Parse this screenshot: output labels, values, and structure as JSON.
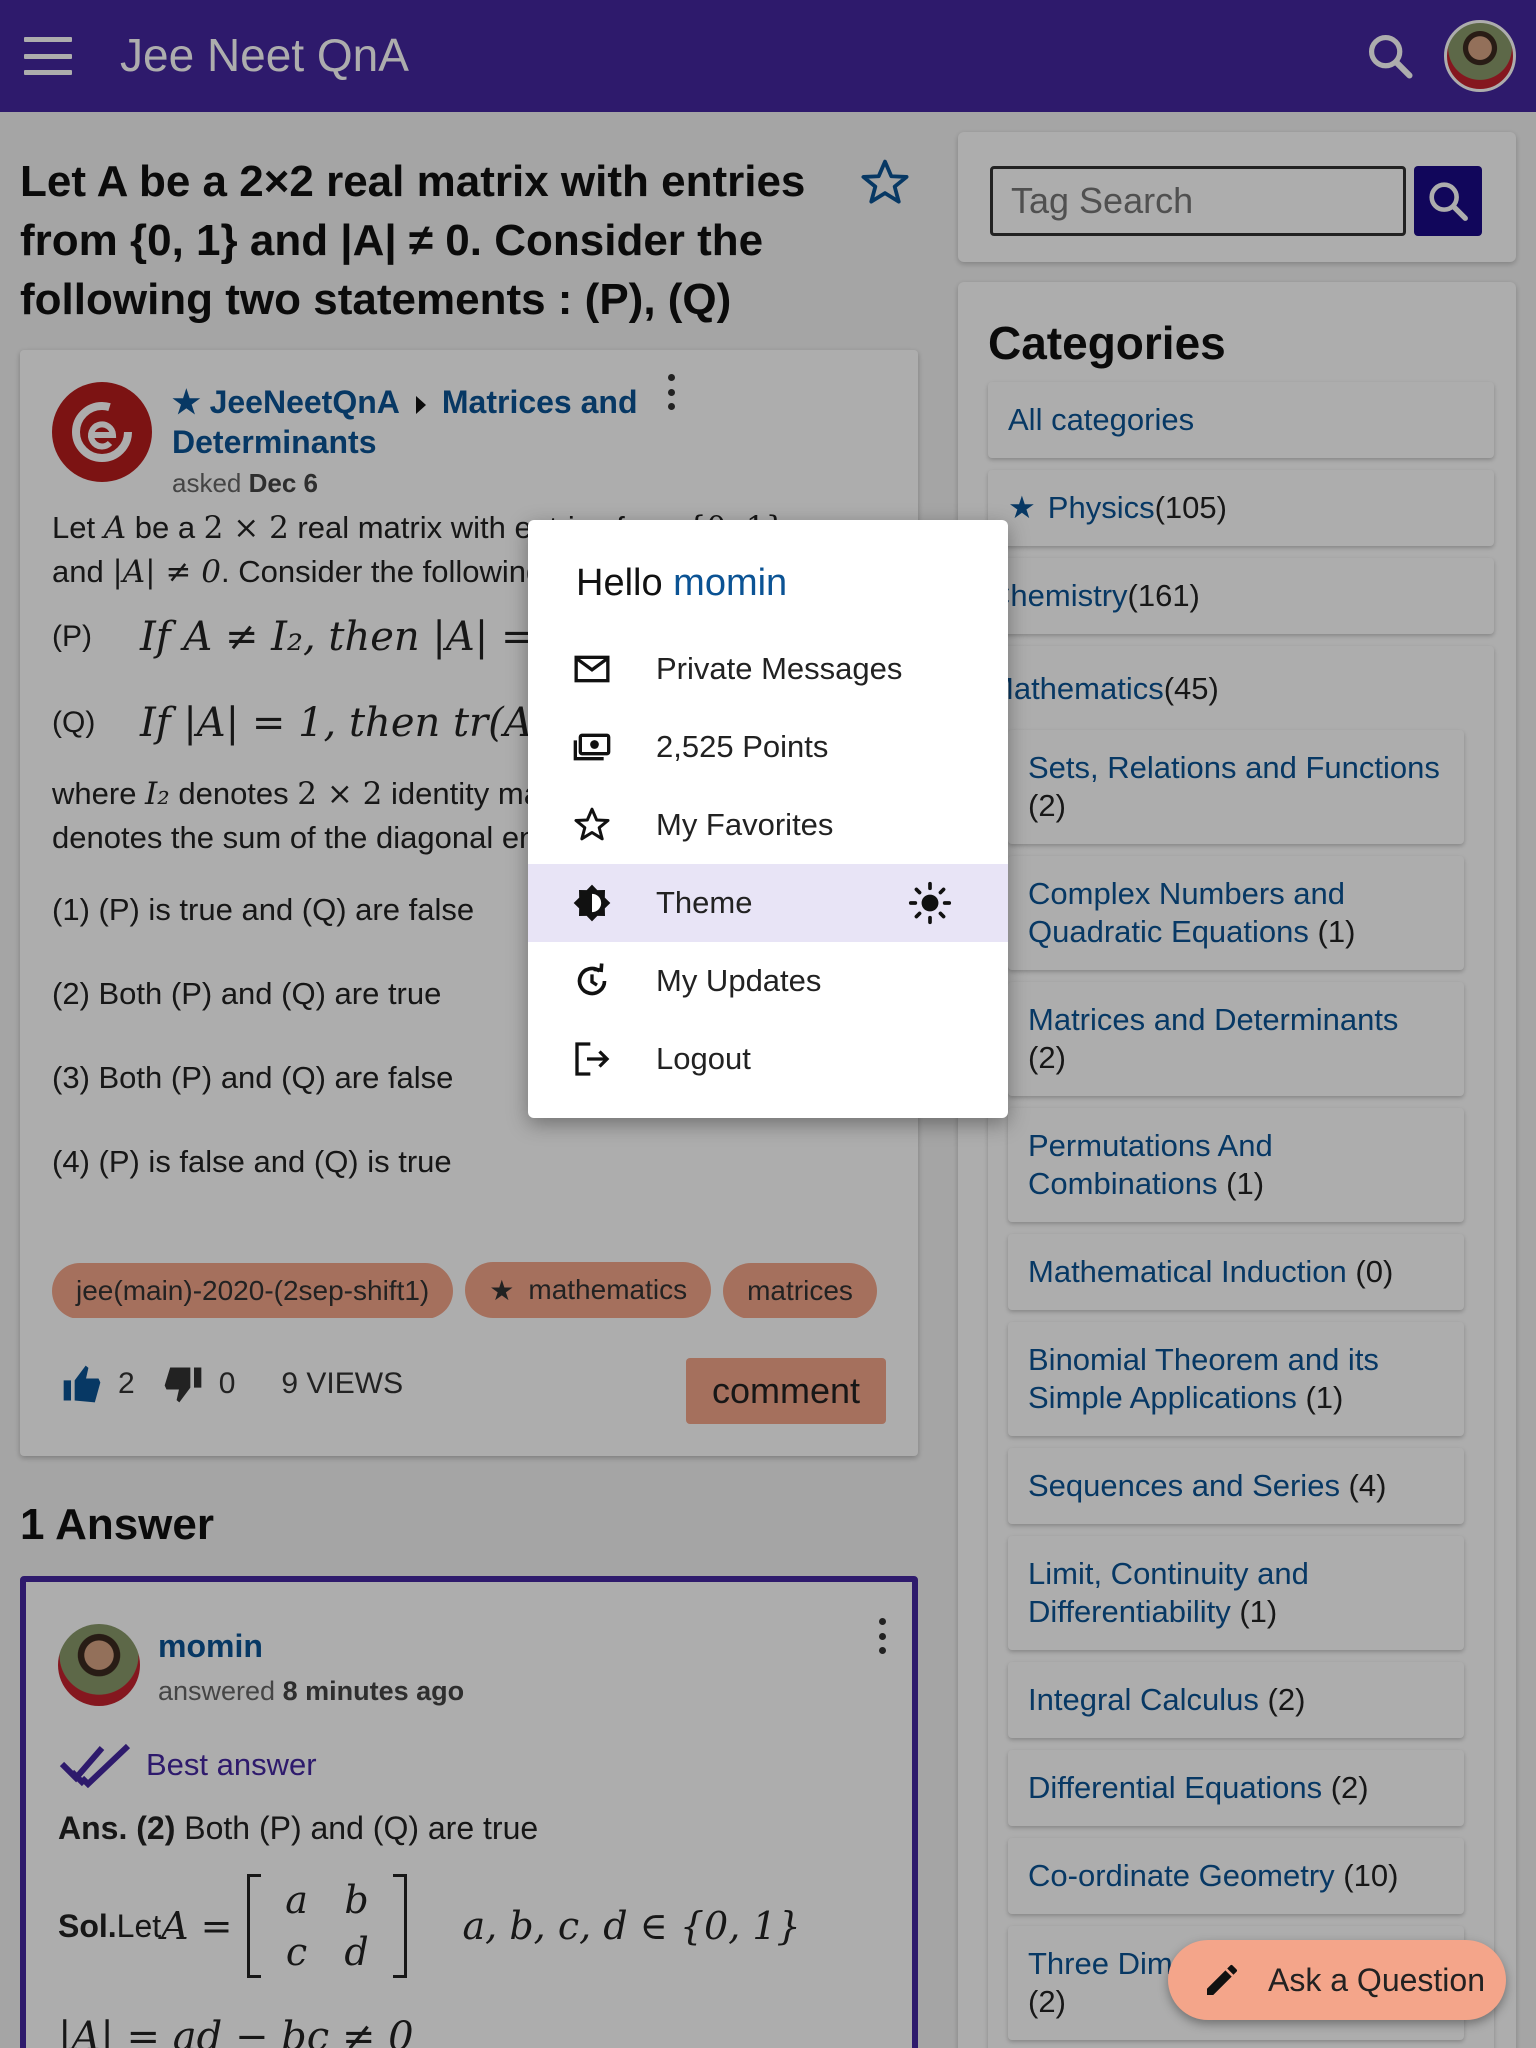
{
  "header": {
    "app_title": "Jee Neet QnA"
  },
  "question": {
    "title": "Let A be a 2×2 real matrix with entries from {0, 1} and |A| ≠ 0. Consider the following two statements : (P), (Q)",
    "site": "JeeNeetQnA",
    "category": "Matrices and Determinants",
    "asked_label": "asked",
    "asked_date": "Dec 6",
    "body": {
      "line1_a": "Let ",
      "line1_b": " be a ",
      "line1_c": " real matrix with entries from ",
      "line2_a": "and ",
      "line2_b": ". Consider the following two statements :",
      "P_label": "(P)",
      "P_math": "If A ≠ I₂, then |A| = −1",
      "Q_label": "(Q)",
      "Q_math": "If |A| = 1, then tr(A) = 2,",
      "where_a": "where ",
      "where_b": " denotes ",
      "where_c": " identity matrix and tr(A)",
      "where_line2": "denotes the sum of the diagonal entries of A. Then"
    },
    "options": [
      "(1) (P) is true and (Q) are false",
      "(2) Both (P) and (Q) are true",
      "(3) Both (P) and (Q) are false",
      "(4) (P) is false and (Q) is true"
    ],
    "tags": [
      "jee(main)-2020-(2sep-shift1)",
      "mathematics",
      "matrices"
    ],
    "upvotes": "2",
    "downvotes": "0",
    "views": "9 VIEWS",
    "comment_label": "comment"
  },
  "answers": {
    "count_label": "1 Answer",
    "user": "momin",
    "answered_label": "answered",
    "answered_when": "8 minutes ago",
    "best_label": "Best answer",
    "ans_prefix": "Ans. (2)",
    "ans_text": " Both (P) and (Q) are true",
    "sol_prefix": "Sol.",
    "sol_text": " Let ",
    "sol_set": "a, b, c, d ∈ {0, 1}",
    "det_line": "|A| = ad − bc ≠ 0"
  },
  "sidebar": {
    "tag_search_placeholder": "Tag Search",
    "categories_title": "Categories",
    "categories": [
      {
        "name": "All categories",
        "count": ""
      },
      {
        "name": "Physics",
        "count": " (105)"
      },
      {
        "name": "Chemistry",
        "count": " (161)"
      },
      {
        "name": "Mathematics",
        "count": " (45)"
      }
    ],
    "subcategories": [
      {
        "name": "Sets, Relations and Functions",
        "count": " (2)"
      },
      {
        "name": "Complex Numbers and Quadratic Equations",
        "count": " (1)"
      },
      {
        "name": "Matrices and Determinants",
        "count": " (2)"
      },
      {
        "name": "Permutations And Combinations",
        "count": " (1)"
      },
      {
        "name": "Mathematical Induction",
        "count": " (0)"
      },
      {
        "name": "Binomial Theorem and its Simple Applications",
        "count": " (1)"
      },
      {
        "name": "Sequences and Series",
        "count": " (4)"
      },
      {
        "name": "Limit, Continuity and Differentiability",
        "count": " (1)"
      },
      {
        "name": "Integral Calculus",
        "count": " (2)"
      },
      {
        "name": "Differential Equations",
        "count": " (2)"
      },
      {
        "name": "Co-ordinate Geometry",
        "count": " (10)"
      },
      {
        "name": "Three Dim",
        "count": "(2)"
      }
    ]
  },
  "user_menu": {
    "hello": "Hello",
    "username": "momin",
    "items": [
      {
        "label": "Private Messages",
        "icon": "mail-icon"
      },
      {
        "label": "2,525 Points",
        "icon": "points-icon"
      },
      {
        "label": "My Favorites",
        "icon": "star-outline-icon"
      },
      {
        "label": "Theme",
        "icon": "theme-icon"
      },
      {
        "label": "My Updates",
        "icon": "updates-icon"
      },
      {
        "label": "Logout",
        "icon": "logout-icon"
      }
    ]
  },
  "fab": {
    "label": "Ask a Question"
  },
  "colors": {
    "primary": "#4527a0",
    "link": "#0b5394",
    "accent": "#f4a58a",
    "search_button": "#1a0a86"
  }
}
